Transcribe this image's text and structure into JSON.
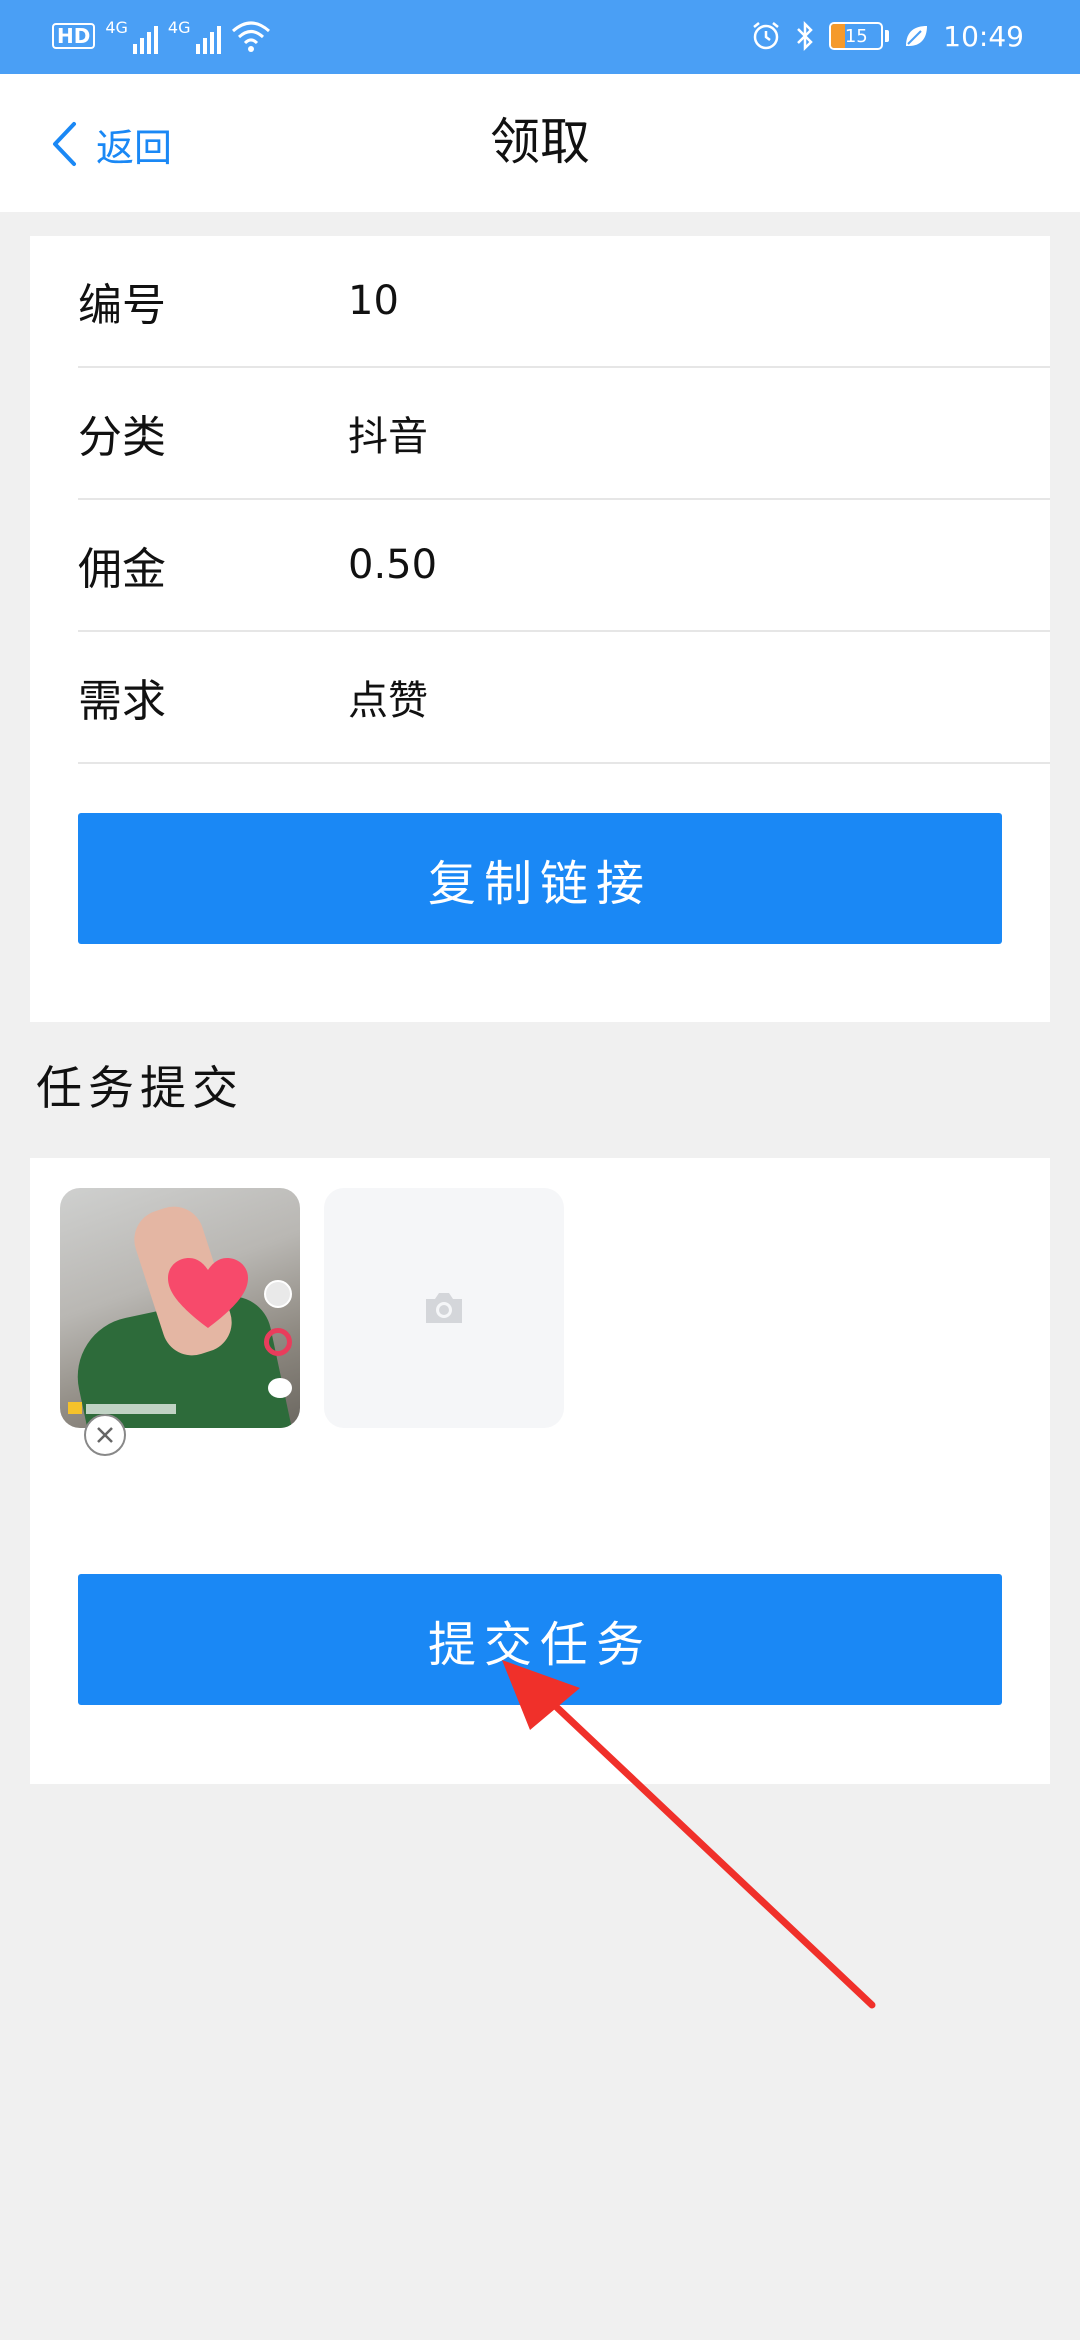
{
  "status_bar": {
    "hd_label": "HD",
    "net1_label": "4G",
    "net2_label": "4G",
    "battery_level": "15",
    "time": "10:49"
  },
  "nav": {
    "back_label": "返回",
    "title": "领取"
  },
  "task_info": {
    "rows": [
      {
        "label": "编号",
        "value": "10"
      },
      {
        "label": "分类",
        "value": "抖音"
      },
      {
        "label": "佣金",
        "value": "0.50"
      },
      {
        "label": "需求",
        "value": "点赞"
      }
    ],
    "copy_button_label": "复制链接"
  },
  "submission": {
    "section_title": "任务提交",
    "submit_button_label": "提交任务"
  },
  "colors": {
    "status_bar_bg": "#4a9ff5",
    "primary": "#1a88f5",
    "annotation_arrow": "#f0302a",
    "page_bg": "#f0f0f0"
  },
  "icons": [
    "chevron-left-icon",
    "camera-icon",
    "close-icon",
    "alarm-icon",
    "bluetooth-icon",
    "wifi-icon",
    "leaf-icon"
  ]
}
